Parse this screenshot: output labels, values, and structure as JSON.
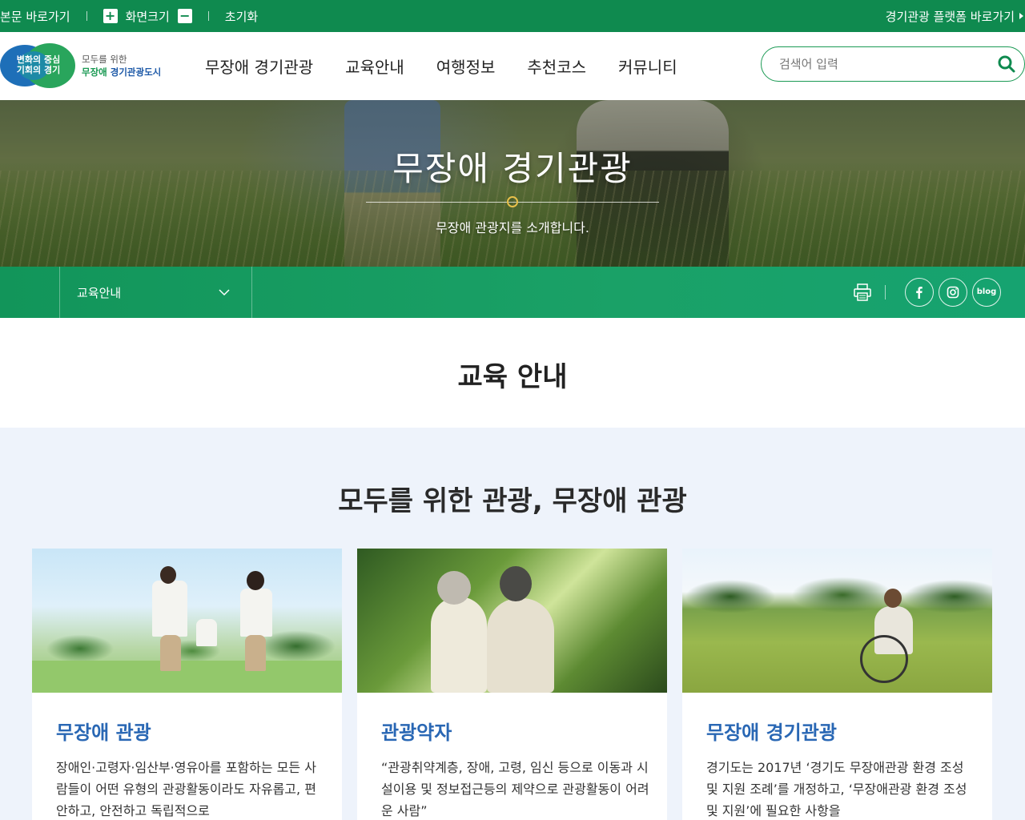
{
  "topbar": {
    "skip_link": "본문 바로가기",
    "zoom_label": "화면크기",
    "zoom_in": "+",
    "zoom_out": "−",
    "reset": "초기화",
    "platform_link": "경기관광 플랫폼 바로가기"
  },
  "logo": {
    "mark_line1": "변화의 중심",
    "mark_line2": "기회의 경기",
    "tagline1": "모두를 위한",
    "tagline2_a": "무장애",
    "tagline2_b": " 경기관광도시"
  },
  "gnb": {
    "items": [
      "무장애 경기관광",
      "교육안내",
      "여행정보",
      "추천코스",
      "커뮤니티"
    ]
  },
  "search": {
    "placeholder": "검색어 입력"
  },
  "hero": {
    "title": "무장애 경기관광",
    "subtitle": "무장애 관광지를 소개합니다."
  },
  "subnav": {
    "dropdown_label": "교육안내",
    "blog_label": "blog"
  },
  "page": {
    "title": "교육 안내"
  },
  "section": {
    "title": "모두를 위한 관광, 무장애 관광"
  },
  "cards": [
    {
      "title": "무장애 관광",
      "desc": "장애인·고령자·임산부·영유아를 포함하는 모든 사람들이 어떤 유형의 관광활동이라도 자유롭고, 편안하고, 안전하고 독립적으로"
    },
    {
      "title": "관광약자",
      "desc": "“관광취약계층, 장애, 고령, 임신 등으로 이동과 시설이용 및 정보접근등의 제약으로 관광활동이 어려운 사람”"
    },
    {
      "title": "무장애 경기관광",
      "desc": "경기도는 2017년 ‘경기도 무장애관광 환경 조성 및 지원 조례’를 개정하고, ‘무장애관광 환경 조성 및 지원’에 필요한 사항을"
    }
  ],
  "colors": {
    "brand_green": "#0f8a4f",
    "accent_blue": "#2967b4",
    "content_bg": "#eef3fb"
  }
}
